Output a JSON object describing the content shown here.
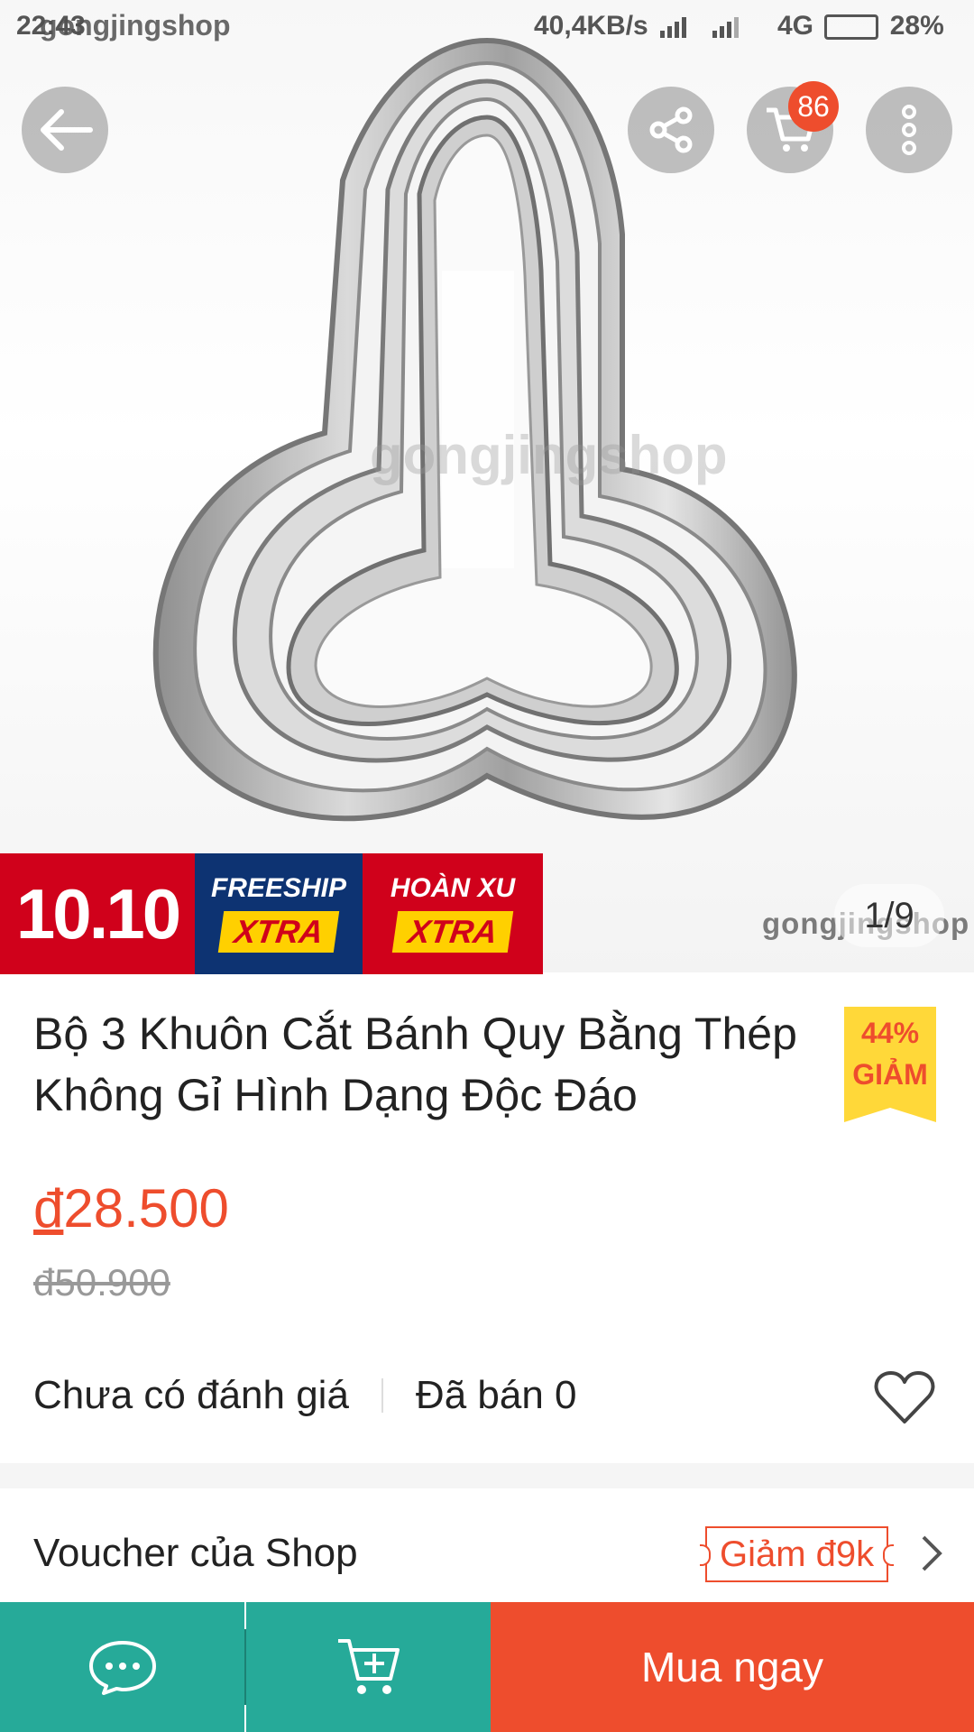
{
  "status_bar": {
    "time": "22:43",
    "shop_watermark": "gongjingshop",
    "network_speed": "40,4KB/s",
    "network_type": "4G",
    "battery": "28%"
  },
  "header": {
    "back_icon": "back-arrow-icon",
    "share_icon": "share-icon",
    "cart_icon": "cart-icon",
    "cart_count": "86",
    "more_icon": "more-vertical-icon"
  },
  "gallery": {
    "watermark_center": "gongjingshop",
    "watermark_corner": "gongjingshop",
    "counter": "1/9"
  },
  "promo": {
    "event": "10.10",
    "freeship_top": "FREESHIP",
    "freeship_bottom": "XTRA",
    "coin_top": "HOÀN XU",
    "coin_bottom": "XTRA"
  },
  "product": {
    "title": "Bộ 3 Khuôn Cắt Bánh Quy Bằng Thép Không Gỉ Hình Dạng Độc Đáo",
    "discount_percent": "44%",
    "discount_label": "GIẢM",
    "currency": "đ",
    "price": "28.500",
    "original_price": "đ50.900",
    "rating_text": "Chưa có đánh giá",
    "sold_text": "Đã bán 0"
  },
  "voucher": {
    "label": "Voucher của Shop",
    "tag": "Giảm đ9k"
  },
  "bottom_bar": {
    "chat_icon": "chat-icon",
    "add_cart_icon": "add-to-cart-icon",
    "buy_now": "Mua ngay"
  },
  "colors": {
    "accent": "#ee4d2d",
    "teal": "#26aa99",
    "promo_red": "#d0011b",
    "promo_blue": "#0d3372",
    "promo_yellow": "#ffd000"
  }
}
